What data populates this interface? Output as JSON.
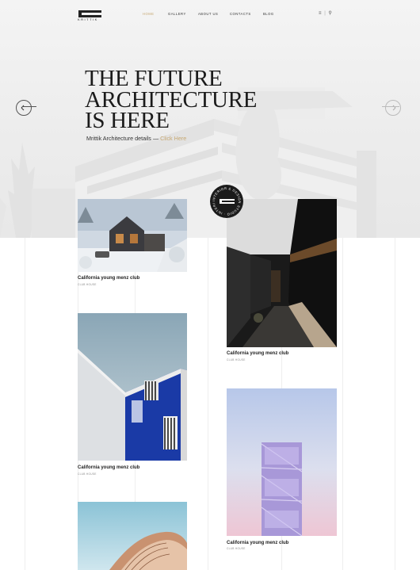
{
  "brand": {
    "name": "KRITTIK"
  },
  "nav": {
    "items": [
      {
        "label": "HOME",
        "active": true
      },
      {
        "label": "GALLERY"
      },
      {
        "label": "ABOUT US"
      },
      {
        "label": "CONTACTS"
      },
      {
        "label": "BLOG"
      }
    ]
  },
  "hero": {
    "title_lines": [
      "THE FUTURE",
      "ARCHITECTURE",
      "IS HERE"
    ],
    "subtitle": "Mrittik Architecture details —",
    "subtitle_link": "Click Here"
  },
  "badge": {
    "text": "INTERIOR & DESIGN STUDIO · INTERIOR & DESIGN STUDIO ·"
  },
  "cards": [
    {
      "title": "California young menz club",
      "sub": "CLUB HOUSE"
    },
    {
      "title": "California young menz club",
      "sub": "CLUB HOUSE"
    },
    {
      "title": "California young menz club",
      "sub": "CLUB HOUSE"
    },
    {
      "title": "California young menz club",
      "sub": "CLUB HOUSE"
    },
    {
      "title": "",
      "sub": ""
    }
  ],
  "colors": {
    "accent": "#c7a872",
    "text": "#1b1b1b"
  }
}
